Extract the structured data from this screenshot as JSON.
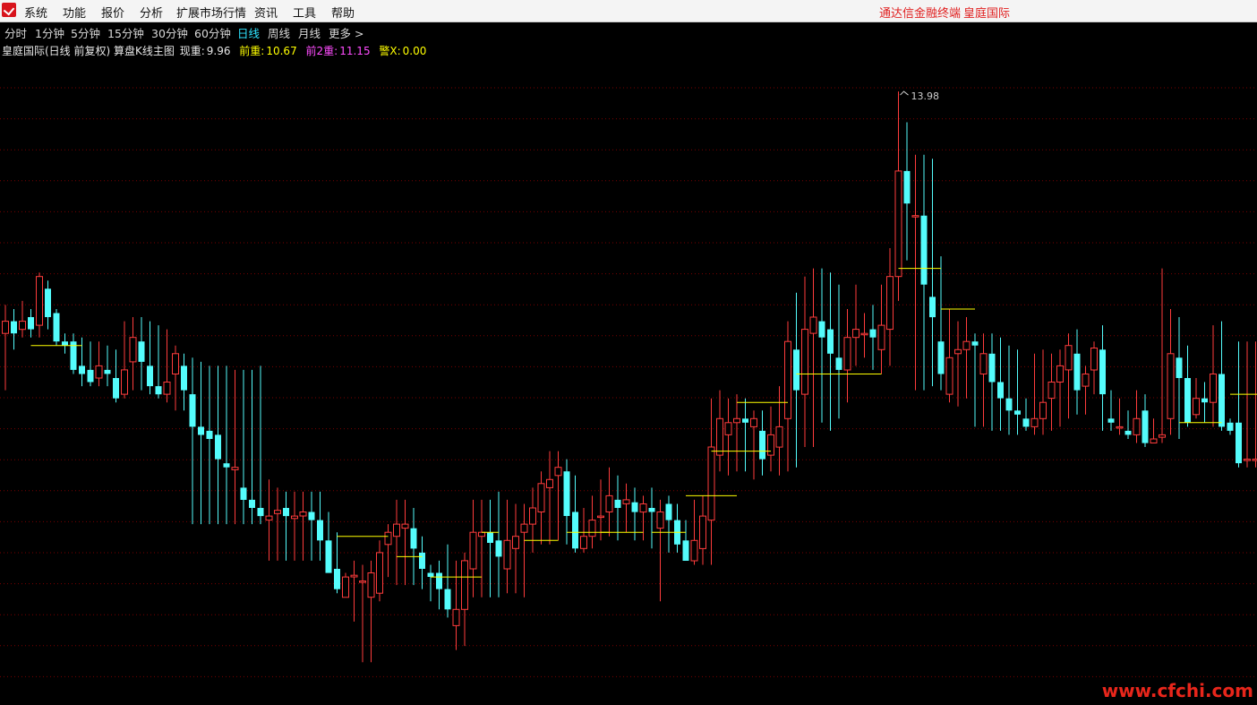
{
  "menubar": {
    "items": [
      "系统",
      "功能",
      "报价",
      "分析",
      "扩展市场行情",
      "资讯",
      "工具",
      "帮助"
    ],
    "title_left": "通达信金融终端",
    "title_right": "皇庭国际"
  },
  "periods": {
    "items": [
      "分时",
      "1分钟",
      "5分钟",
      "15分钟",
      "30分钟",
      "60分钟",
      "日线",
      "周线",
      "月线",
      "更多 >"
    ],
    "active": "日线"
  },
  "info": {
    "title": "皇庭国际(日线 前复权) 算盘K线主图",
    "current_label": "现重:",
    "current_value": "9.96",
    "prev_label": "前重:",
    "prev_value": "10.67",
    "prev2_label": "前2重:",
    "prev2_value": "11.15",
    "alert_label": "警X:",
    "alert_value": "0.00"
  },
  "colors": {
    "up": "#ff3c3c",
    "down": "#54fcfc",
    "level": "#ffff00",
    "grid": "#7a0000",
    "active_period": "#2fe4ff"
  },
  "chart_data": {
    "type": "candlestick",
    "max_label": "13.98",
    "ylim": [
      6.5,
      14.4
    ],
    "grid": true,
    "candles": [
      {
        "o": 11.0,
        "c": 11.15,
        "h": 11.35,
        "l": 10.3
      },
      {
        "o": 11.15,
        "c": 11.0,
        "h": 11.3,
        "l": 10.8
      },
      {
        "o": 11.05,
        "c": 11.15,
        "h": 11.4,
        "l": 10.95
      },
      {
        "o": 11.2,
        "c": 11.05,
        "h": 11.3,
        "l": 10.95
      },
      {
        "o": 11.1,
        "c": 11.7,
        "h": 11.75,
        "l": 10.95
      },
      {
        "o": 11.55,
        "c": 11.2,
        "h": 11.65,
        "l": 11.05
      },
      {
        "o": 11.25,
        "c": 10.9,
        "h": 11.3,
        "l": 10.85
      },
      {
        "o": 10.9,
        "c": 10.85,
        "h": 11.0,
        "l": 10.75
      },
      {
        "o": 10.9,
        "c": 10.55,
        "h": 11.0,
        "l": 10.5
      },
      {
        "o": 10.6,
        "c": 10.5,
        "h": 10.95,
        "l": 10.35
      },
      {
        "o": 10.55,
        "c": 10.4,
        "h": 10.9,
        "l": 10.35
      },
      {
        "o": 10.45,
        "c": 10.6,
        "h": 10.9,
        "l": 10.35
      },
      {
        "o": 10.55,
        "c": 10.5,
        "h": 10.85,
        "l": 10.35
      },
      {
        "o": 10.45,
        "c": 10.2,
        "h": 10.8,
        "l": 10.15
      },
      {
        "o": 10.25,
        "c": 10.55,
        "h": 11.15,
        "l": 10.2
      },
      {
        "o": 10.65,
        "c": 10.95,
        "h": 11.2,
        "l": 10.3
      },
      {
        "o": 10.9,
        "c": 10.65,
        "h": 11.2,
        "l": 10.3
      },
      {
        "o": 10.6,
        "c": 10.35,
        "h": 11.15,
        "l": 10.25
      },
      {
        "o": 10.35,
        "c": 10.25,
        "h": 11.1,
        "l": 10.2
      },
      {
        "o": 10.25,
        "c": 10.4,
        "h": 11.05,
        "l": 10.15
      },
      {
        "o": 10.5,
        "c": 10.75,
        "h": 10.85,
        "l": 10.05
      },
      {
        "o": 10.6,
        "c": 10.3,
        "h": 10.75,
        "l": 10.05
      },
      {
        "o": 10.25,
        "c": 9.85,
        "h": 10.7,
        "l": 8.65
      },
      {
        "o": 9.85,
        "c": 9.75,
        "h": 10.65,
        "l": 8.65
      },
      {
        "o": 9.8,
        "c": 9.7,
        "h": 10.6,
        "l": 8.65
      },
      {
        "o": 9.75,
        "c": 9.45,
        "h": 10.6,
        "l": 8.65
      },
      {
        "o": 9.4,
        "c": 9.35,
        "h": 10.6,
        "l": 8.65
      },
      {
        "o": 9.32,
        "c": 9.35,
        "h": 10.55,
        "l": 8.65
      },
      {
        "o": 9.1,
        "c": 8.95,
        "h": 10.55,
        "l": 8.65
      },
      {
        "o": 8.95,
        "c": 8.85,
        "h": 10.55,
        "l": 8.65
      },
      {
        "o": 8.85,
        "c": 8.75,
        "h": 10.6,
        "l": 8.65
      },
      {
        "o": 8.7,
        "c": 8.75,
        "h": 9.2,
        "l": 8.2
      },
      {
        "o": 8.78,
        "c": 8.82,
        "h": 9.1,
        "l": 8.2
      },
      {
        "o": 8.85,
        "c": 8.75,
        "h": 9.05,
        "l": 8.2
      },
      {
        "o": 8.72,
        "c": 8.75,
        "h": 9.05,
        "l": 8.2
      },
      {
        "o": 8.75,
        "c": 8.8,
        "h": 9.05,
        "l": 8.2
      },
      {
        "o": 8.8,
        "c": 8.7,
        "h": 9.05,
        "l": 8.2
      },
      {
        "o": 8.7,
        "c": 8.45,
        "h": 9.05,
        "l": 8.2
      },
      {
        "o": 8.45,
        "c": 8.05,
        "h": 8.8,
        "l": 8.2
      },
      {
        "o": 8.1,
        "c": 7.85,
        "h": 8.55,
        "l": 7.8
      },
      {
        "o": 7.75,
        "c": 8.0,
        "h": 8.05,
        "l": 7.75
      },
      {
        "o": 8.0,
        "c": 8.02,
        "h": 8.2,
        "l": 7.45
      },
      {
        "o": 7.95,
        "c": 7.95,
        "h": 8.15,
        "l": 6.95
      },
      {
        "o": 7.75,
        "c": 8.05,
        "h": 8.2,
        "l": 6.95
      },
      {
        "o": 7.8,
        "c": 8.3,
        "h": 8.45,
        "l": 7.7
      },
      {
        "o": 8.4,
        "c": 8.55,
        "h": 8.65,
        "l": 8.0
      },
      {
        "o": 8.5,
        "c": 8.65,
        "h": 8.95,
        "l": 7.9
      },
      {
        "o": 8.6,
        "c": 8.65,
        "h": 8.95,
        "l": 7.9
      },
      {
        "o": 8.6,
        "c": 8.35,
        "h": 8.85,
        "l": 7.9
      },
      {
        "o": 8.3,
        "c": 8.1,
        "h": 8.5,
        "l": 7.85
      },
      {
        "o": 8.05,
        "c": 8.0,
        "h": 8.15,
        "l": 7.7
      },
      {
        "o": 8.05,
        "c": 7.85,
        "h": 8.2,
        "l": 7.6
      },
      {
        "o": 7.85,
        "c": 7.6,
        "h": 8.4,
        "l": 7.5
      },
      {
        "o": 7.4,
        "c": 7.6,
        "h": 8.2,
        "l": 7.1
      },
      {
        "o": 7.6,
        "c": 8.2,
        "h": 8.3,
        "l": 7.15
      },
      {
        "o": 8.1,
        "c": 8.55,
        "h": 8.95,
        "l": 7.75
      },
      {
        "o": 8.5,
        "c": 8.55,
        "h": 8.95,
        "l": 7.75
      },
      {
        "o": 8.55,
        "c": 8.42,
        "h": 8.95,
        "l": 7.75
      },
      {
        "o": 8.45,
        "c": 8.25,
        "h": 9.05,
        "l": 7.75
      },
      {
        "o": 8.1,
        "c": 8.45,
        "h": 8.95,
        "l": 7.8
      },
      {
        "o": 8.35,
        "c": 8.5,
        "h": 8.9,
        "l": 7.8
      },
      {
        "o": 8.55,
        "c": 8.65,
        "h": 8.9,
        "l": 7.75
      },
      {
        "o": 8.65,
        "c": 8.85,
        "h": 9.1,
        "l": 8.3
      },
      {
        "o": 8.8,
        "c": 9.15,
        "h": 9.3,
        "l": 8.4
      },
      {
        "o": 9.1,
        "c": 9.2,
        "h": 9.55,
        "l": 8.4
      },
      {
        "o": 9.25,
        "c": 9.35,
        "h": 9.55,
        "l": 8.45
      },
      {
        "o": 9.3,
        "c": 8.75,
        "h": 9.45,
        "l": 8.4
      },
      {
        "o": 8.8,
        "c": 8.35,
        "h": 9.25,
        "l": 8.3
      },
      {
        "o": 8.35,
        "c": 8.5,
        "h": 8.85,
        "l": 8.3
      },
      {
        "o": 8.5,
        "c": 8.7,
        "h": 9.0,
        "l": 8.35
      },
      {
        "o": 8.75,
        "c": 8.75,
        "h": 9.2,
        "l": 8.45
      },
      {
        "o": 8.8,
        "c": 9.0,
        "h": 9.35,
        "l": 8.5
      },
      {
        "o": 8.95,
        "c": 8.85,
        "h": 9.25,
        "l": 8.45
      },
      {
        "o": 8.9,
        "c": 8.95,
        "h": 9.15,
        "l": 8.55
      },
      {
        "o": 8.92,
        "c": 8.8,
        "h": 9.1,
        "l": 8.45
      },
      {
        "o": 8.8,
        "c": 8.9,
        "h": 9.0,
        "l": 8.45
      },
      {
        "o": 8.85,
        "c": 8.8,
        "h": 9.1,
        "l": 8.35
      },
      {
        "o": 8.6,
        "c": 8.8,
        "h": 8.95,
        "l": 7.7
      },
      {
        "o": 8.9,
        "c": 8.7,
        "h": 9.0,
        "l": 8.3
      },
      {
        "o": 8.7,
        "c": 8.4,
        "h": 8.9,
        "l": 8.3
      },
      {
        "o": 8.45,
        "c": 8.2,
        "h": 8.7,
        "l": 8.2
      },
      {
        "o": 8.2,
        "c": 8.45,
        "h": 8.95,
        "l": 8.15
      },
      {
        "o": 8.35,
        "c": 8.75,
        "h": 9.0,
        "l": 8.15
      },
      {
        "o": 8.7,
        "c": 9.6,
        "h": 10.2,
        "l": 8.15
      },
      {
        "o": 9.5,
        "c": 9.95,
        "h": 10.3,
        "l": 9.3
      },
      {
        "o": 9.75,
        "c": 9.9,
        "h": 10.2,
        "l": 9.25
      },
      {
        "o": 9.9,
        "c": 9.95,
        "h": 10.25,
        "l": 9.3
      },
      {
        "o": 9.95,
        "c": 9.9,
        "h": 10.2,
        "l": 9.3
      },
      {
        "o": 9.85,
        "c": 9.95,
        "h": 10.05,
        "l": 9.2
      },
      {
        "o": 9.8,
        "c": 9.45,
        "h": 10.05,
        "l": 9.25
      },
      {
        "o": 9.5,
        "c": 9.75,
        "h": 10.1,
        "l": 9.3
      },
      {
        "o": 9.6,
        "c": 9.85,
        "h": 10.35,
        "l": 9.25
      },
      {
        "o": 9.95,
        "c": 10.9,
        "h": 11.15,
        "l": 9.3
      },
      {
        "o": 10.8,
        "c": 10.3,
        "h": 11.5,
        "l": 9.35
      },
      {
        "o": 10.25,
        "c": 11.05,
        "h": 11.7,
        "l": 9.6
      },
      {
        "o": 11.0,
        "c": 11.2,
        "h": 11.8,
        "l": 9.6
      },
      {
        "o": 11.15,
        "c": 10.95,
        "h": 11.8,
        "l": 9.9
      },
      {
        "o": 11.05,
        "c": 10.75,
        "h": 11.75,
        "l": 9.8
      },
      {
        "o": 10.7,
        "c": 10.55,
        "h": 11.6,
        "l": 9.95
      },
      {
        "o": 10.55,
        "c": 10.95,
        "h": 11.3,
        "l": 10.15
      },
      {
        "o": 10.95,
        "c": 11.05,
        "h": 11.6,
        "l": 10.6
      },
      {
        "o": 11.0,
        "c": 11.0,
        "h": 11.25,
        "l": 10.7
      },
      {
        "o": 11.05,
        "c": 10.95,
        "h": 11.35,
        "l": 10.55
      },
      {
        "o": 10.8,
        "c": 11.1,
        "h": 11.6,
        "l": 10.5
      },
      {
        "o": 11.05,
        "c": 11.7,
        "h": 12.05,
        "l": 10.6
      },
      {
        "o": 11.7,
        "c": 13.0,
        "h": 13.98,
        "l": 11.4
      },
      {
        "o": 13.0,
        "c": 12.6,
        "h": 13.6,
        "l": 11.9
      },
      {
        "o": 12.45,
        "c": 12.45,
        "h": 13.2,
        "l": 10.3
      },
      {
        "o": 12.45,
        "c": 11.6,
        "h": 13.2,
        "l": 10.3
      },
      {
        "o": 11.45,
        "c": 11.2,
        "h": 13.15,
        "l": 10.35
      },
      {
        "o": 10.9,
        "c": 10.5,
        "h": 11.95,
        "l": 10.3
      },
      {
        "o": 10.25,
        "c": 10.7,
        "h": 11.3,
        "l": 10.15
      },
      {
        "o": 10.75,
        "c": 10.8,
        "h": 11.15,
        "l": 10.1
      },
      {
        "o": 10.8,
        "c": 10.9,
        "h": 11.2,
        "l": 10.2
      },
      {
        "o": 10.9,
        "c": 10.85,
        "h": 11.0,
        "l": 9.85
      },
      {
        "o": 10.5,
        "c": 10.75,
        "h": 11.0,
        "l": 9.85
      },
      {
        "o": 10.75,
        "c": 10.4,
        "h": 11.0,
        "l": 9.8
      },
      {
        "o": 10.4,
        "c": 10.2,
        "h": 10.95,
        "l": 9.8
      },
      {
        "o": 10.2,
        "c": 10.05,
        "h": 10.85,
        "l": 9.75
      },
      {
        "o": 10.05,
        "c": 10.0,
        "h": 10.8,
        "l": 9.75
      },
      {
        "o": 9.95,
        "c": 9.85,
        "h": 10.2,
        "l": 9.8
      },
      {
        "o": 9.85,
        "c": 9.95,
        "h": 10.75,
        "l": 9.75
      },
      {
        "o": 9.95,
        "c": 10.15,
        "h": 10.8,
        "l": 9.75
      },
      {
        "o": 10.2,
        "c": 10.4,
        "h": 10.75,
        "l": 9.8
      },
      {
        "o": 10.4,
        "c": 10.6,
        "h": 10.8,
        "l": 9.85
      },
      {
        "o": 10.55,
        "c": 10.85,
        "h": 11.0,
        "l": 9.95
      },
      {
        "o": 10.75,
        "c": 10.3,
        "h": 11.05,
        "l": 10.0
      },
      {
        "o": 10.35,
        "c": 10.5,
        "h": 10.6,
        "l": 10.0
      },
      {
        "o": 10.55,
        "c": 10.82,
        "h": 10.9,
        "l": 10.25
      },
      {
        "o": 10.8,
        "c": 10.25,
        "h": 11.1,
        "l": 9.8
      },
      {
        "o": 9.95,
        "c": 9.9,
        "h": 10.3,
        "l": 9.8
      },
      {
        "o": 9.85,
        "c": 9.85,
        "h": 10.2,
        "l": 9.75
      },
      {
        "o": 9.8,
        "c": 9.75,
        "h": 10.05,
        "l": 9.7
      },
      {
        "o": 9.75,
        "c": 9.95,
        "h": 10.3,
        "l": 9.65
      },
      {
        "o": 10.05,
        "c": 9.65,
        "h": 10.25,
        "l": 9.6
      },
      {
        "o": 9.65,
        "c": 9.7,
        "h": 9.95,
        "l": 9.65
      },
      {
        "o": 9.72,
        "c": 9.75,
        "h": 11.8,
        "l": 9.65
      },
      {
        "o": 9.95,
        "c": 10.75,
        "h": 11.3,
        "l": 9.75
      },
      {
        "o": 10.7,
        "c": 10.45,
        "h": 11.2,
        "l": 9.7
      },
      {
        "o": 10.45,
        "c": 9.9,
        "h": 10.85,
        "l": 9.85
      },
      {
        "o": 10.0,
        "c": 10.2,
        "h": 10.45,
        "l": 9.95
      },
      {
        "o": 10.2,
        "c": 10.15,
        "h": 10.4,
        "l": 9.9
      },
      {
        "o": 10.15,
        "c": 10.5,
        "h": 11.1,
        "l": 9.85
      },
      {
        "o": 10.5,
        "c": 9.85,
        "h": 11.15,
        "l": 9.8
      },
      {
        "o": 9.9,
        "c": 9.8,
        "h": 9.95,
        "l": 9.75
      },
      {
        "o": 9.9,
        "c": 9.4,
        "h": 10.9,
        "l": 9.35
      },
      {
        "o": 9.45,
        "c": 9.45,
        "h": 10.9,
        "l": 9.35
      },
      {
        "o": 9.45,
        "c": 9.45,
        "h": 10.9,
        "l": 9.35
      },
      {
        "o": 9.45,
        "c": 9.6,
        "h": 10.9,
        "l": 9.35
      },
      {
        "o": 9.6,
        "c": 10.1,
        "h": 10.9,
        "l": 9.4
      },
      {
        "o": 10.1,
        "c": 10.6,
        "h": 10.9,
        "l": 9.45
      },
      {
        "o": 10.5,
        "c": 10.85,
        "h": 10.95,
        "l": 9.4
      },
      {
        "o": 10.8,
        "c": 10.85,
        "h": 11.0,
        "l": 9.45
      },
      {
        "o": 10.9,
        "c": 11.05,
        "h": 11.05,
        "l": 9.45
      },
      {
        "o": 11.08,
        "c": 11.1,
        "h": 11.2,
        "l": 10.6
      },
      {
        "o": 10.85,
        "c": 10.75,
        "h": 11.2,
        "l": 10.7
      },
      {
        "o": 10.85,
        "c": 10.55,
        "h": 11.25,
        "l": 10.5
      },
      {
        "o": 10.55,
        "c": 10.85,
        "h": 11.05,
        "l": 10.45
      },
      {
        "o": 10.6,
        "c": 10.9,
        "h": 11.35,
        "l": 10.45
      },
      {
        "o": 10.4,
        "c": 10.6,
        "h": 11.0,
        "l": 10.45
      },
      {
        "o": 10.7,
        "c": 11.2,
        "h": 12.55,
        "l": 10.6
      },
      {
        "o": 11.15,
        "c": 11.8,
        "h": 12.6,
        "l": 10.7
      },
      {
        "o": 11.75,
        "c": 11.1,
        "h": 12.0,
        "l": 10.6
      },
      {
        "o": 11.05,
        "c": 10.85,
        "h": 12.3,
        "l": 10.6
      }
    ],
    "levels": [
      {
        "from": 3,
        "to": 9,
        "price": 10.85
      },
      {
        "from": 39,
        "to": 45,
        "price": 8.5
      },
      {
        "from": 46,
        "to": 49,
        "price": 8.25
      },
      {
        "from": 50,
        "to": 56,
        "price": 8.0
      },
      {
        "from": 56,
        "to": 58,
        "price": 8.55
      },
      {
        "from": 61,
        "to": 65,
        "price": 8.45
      },
      {
        "from": 66,
        "to": 71,
        "price": 8.55
      },
      {
        "from": 70,
        "to": 75,
        "price": 8.55
      },
      {
        "from": 76,
        "to": 80,
        "price": 8.55
      },
      {
        "from": 80,
        "to": 86,
        "price": 9.0
      },
      {
        "from": 83,
        "to": 90,
        "price": 9.55
      },
      {
        "from": 86,
        "to": 92,
        "price": 10.15
      },
      {
        "from": 93,
        "to": 103,
        "price": 10.5
      },
      {
        "from": 105,
        "to": 110,
        "price": 11.8
      },
      {
        "from": 110,
        "to": 114,
        "price": 11.3
      },
      {
        "from": 138,
        "to": 143,
        "price": 9.9
      },
      {
        "from": 144,
        "to": 152,
        "price": 10.25
      },
      {
        "from": 152,
        "to": 159,
        "price": 10.35
      },
      {
        "from": 157,
        "to": 162,
        "price": 10.65
      }
    ]
  }
}
